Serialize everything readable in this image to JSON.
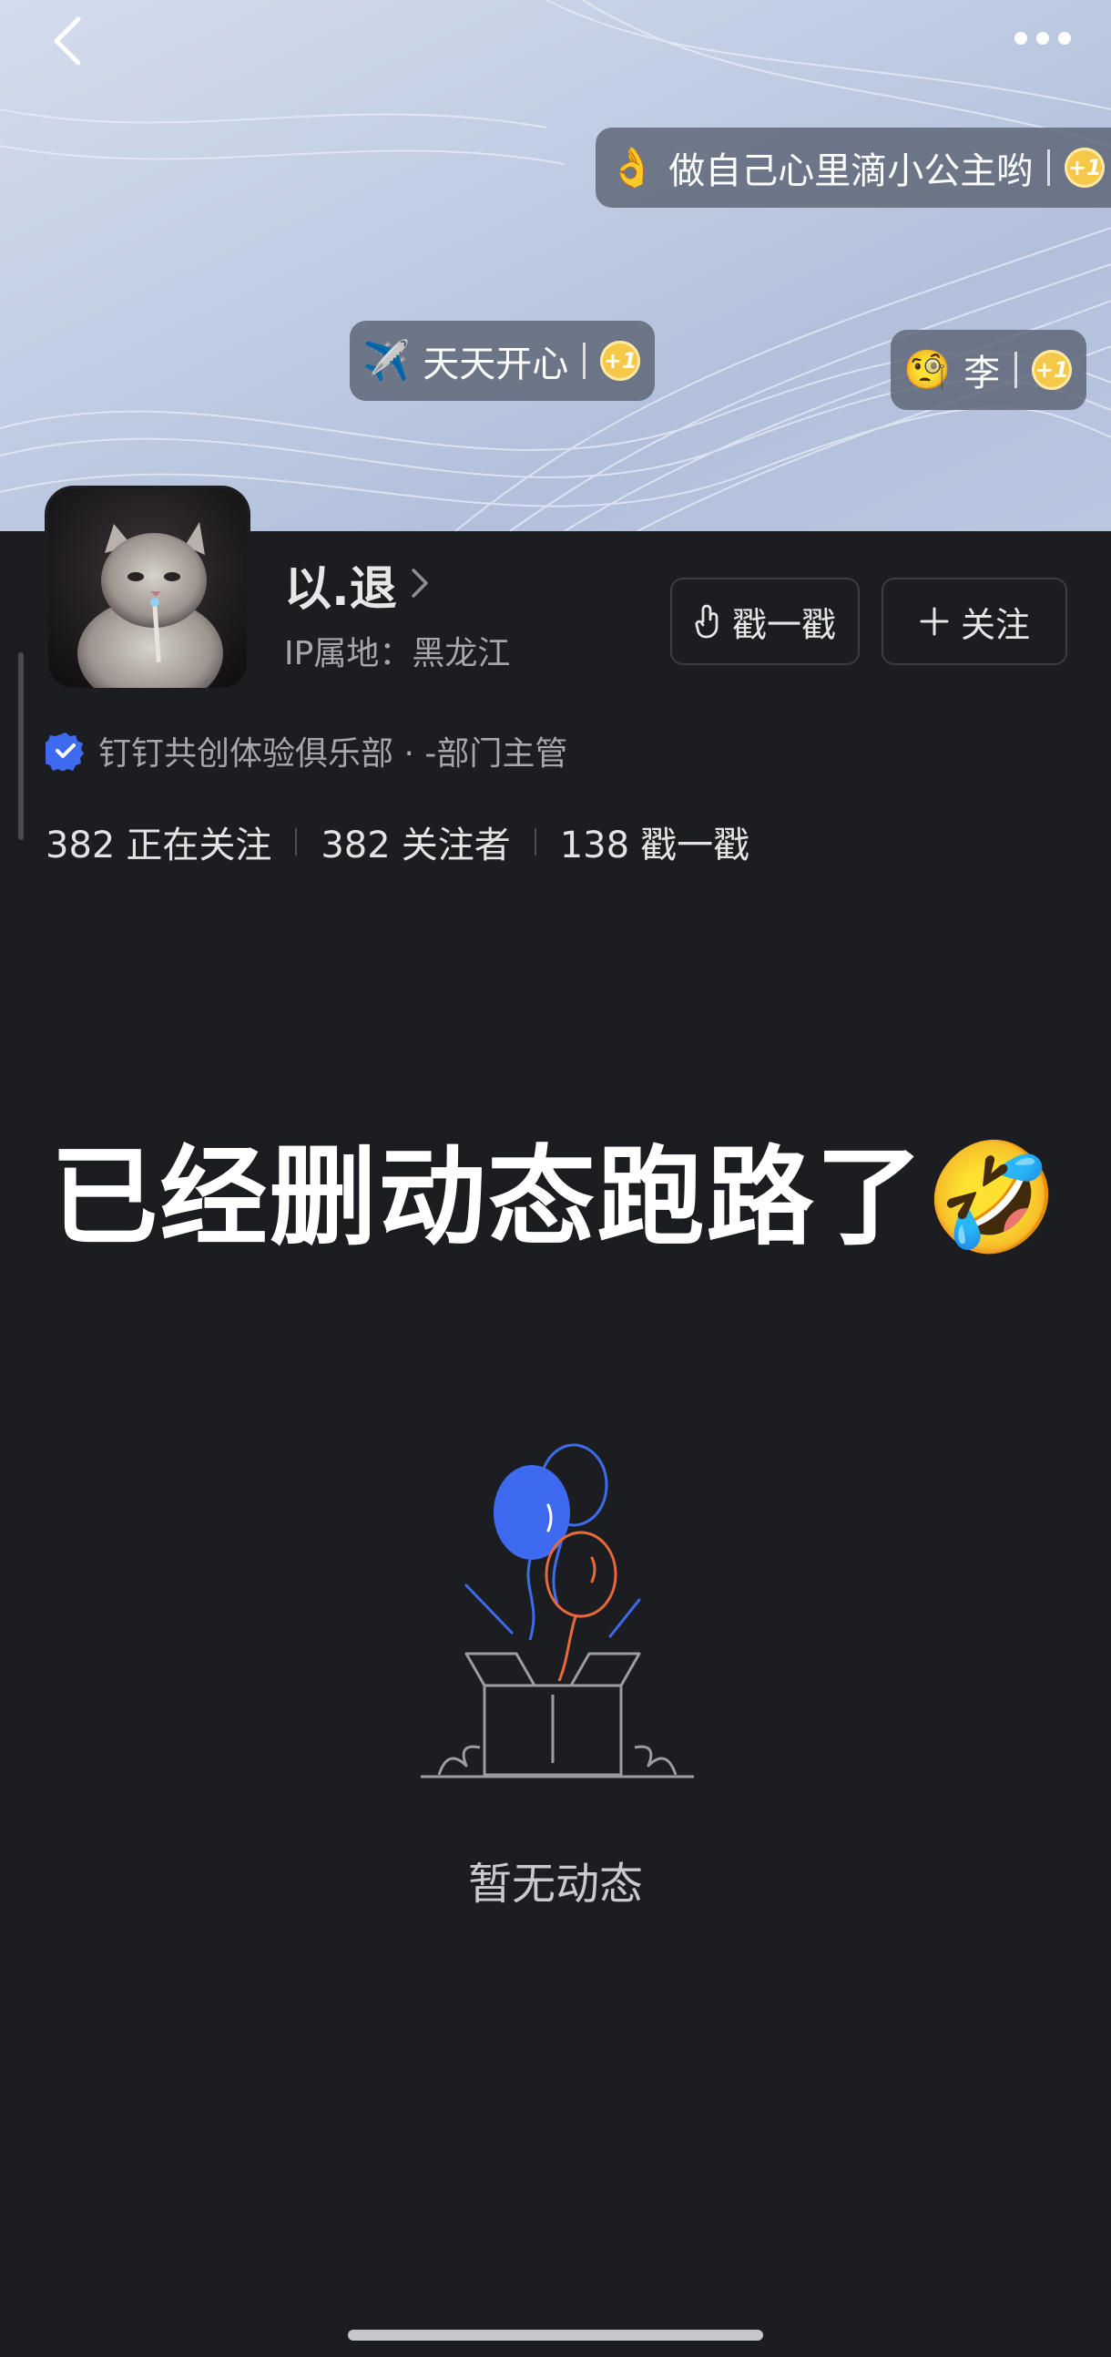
{
  "cover": {
    "bubbles": [
      {
        "emoji": "👌",
        "text": "做自己心里滴小公主哟",
        "plus": "+1"
      },
      {
        "emoji": "✈️",
        "text": "天天开心",
        "plus": "+1"
      },
      {
        "emoji": "🧐",
        "text": "李",
        "plus": "+1"
      }
    ]
  },
  "profile": {
    "name": "以.退",
    "ip_location": "IP属地：黑龙江",
    "org_line": "钉钉共创体验俱乐部 · -部门主管"
  },
  "actions": {
    "poke_label": "戳一戳",
    "follow_label": "关注"
  },
  "stats": [
    {
      "count": "382",
      "label": "正在关注"
    },
    {
      "count": "382",
      "label": "关注者"
    },
    {
      "count": "138",
      "label": "戳一戳"
    }
  ],
  "headline": {
    "text": "已经删动态跑路了",
    "emoji": "🤣"
  },
  "empty_state": {
    "text": "暂无动态"
  },
  "icons": {
    "back": "back-chevron-icon",
    "more": "more-dots-icon",
    "verified": "verified-badge-icon",
    "poke": "finger-tap-icon",
    "follow": "plus-icon",
    "empty": "gift-box-balloons-icon"
  },
  "colors": {
    "page_background": "#1c1d20",
    "accent_blue": "#3e6af0",
    "balloon_orange": "#e86a3a",
    "plus_one_gold": "#f6c84a"
  }
}
